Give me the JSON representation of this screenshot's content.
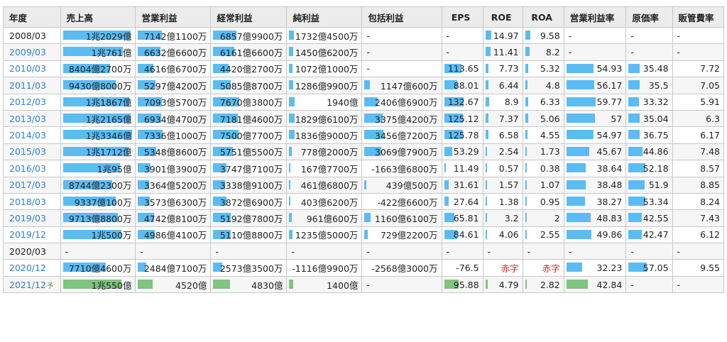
{
  "colors": {
    "actual_bar": "#5bbcf3",
    "forecast_bar": "#7fc47f",
    "link": "#2d7ed8",
    "deficit": "#dd2222"
  },
  "headers": [
    "年度",
    "売上高",
    "営業利益",
    "経常利益",
    "純利益",
    "包括利益",
    "EPS",
    "ROE",
    "ROA",
    "営業利益率",
    "原価率",
    "販管費率"
  ],
  "rows": [
    {
      "year": "2008/03",
      "link": false,
      "cells": [
        {
          "text": "1兆2029億",
          "bar": 0.98
        },
        {
          "text": "7142億1100万",
          "bar": 0.35
        },
        {
          "text": "6857億9900万",
          "bar": 0.34
        },
        {
          "text": "1732億4500万",
          "bar": 0.07
        },
        {
          "text": "-",
          "bar": 0
        },
        {
          "text": "-",
          "bar": 0
        },
        {
          "text": "14.97",
          "bar": 0.18
        },
        {
          "text": "9.58",
          "bar": 0.14
        },
        {
          "text": "-",
          "bar": 0
        },
        {
          "text": "-",
          "bar": 0
        },
        {
          "text": "-",
          "bar": 0
        }
      ]
    },
    {
      "year": "2009/03",
      "link": true,
      "cells": [
        {
          "text": "1兆761億",
          "bar": 0.87
        },
        {
          "text": "6632億6600万",
          "bar": 0.33
        },
        {
          "text": "6161億6600万",
          "bar": 0.31
        },
        {
          "text": "1450億6200万",
          "bar": 0.06
        },
        {
          "text": "-",
          "bar": 0
        },
        {
          "text": "-",
          "bar": 0
        },
        {
          "text": "11.41",
          "bar": 0.14
        },
        {
          "text": "8.2",
          "bar": 0.12
        },
        {
          "text": "-",
          "bar": 0
        },
        {
          "text": "-",
          "bar": 0
        },
        {
          "text": "-",
          "bar": 0
        }
      ]
    },
    {
      "year": "2010/03",
      "link": true,
      "cells": [
        {
          "text": "8404億2700万",
          "bar": 0.68
        },
        {
          "text": "4616億6700万",
          "bar": 0.23
        },
        {
          "text": "4420億2700万",
          "bar": 0.22
        },
        {
          "text": "1072億1000万",
          "bar": 0.05
        },
        {
          "text": "-",
          "bar": 0
        },
        {
          "text": "113.65",
          "bar": 0.48
        },
        {
          "text": "7.73",
          "bar": 0.09
        },
        {
          "text": "5.32",
          "bar": 0.08
        },
        {
          "text": "54.93",
          "bar": 0.48
        },
        {
          "text": "35.48",
          "bar": 0.28
        },
        {
          "text": "7.72",
          "bar": 0
        }
      ]
    },
    {
      "year": "2011/03",
      "link": true,
      "cells": [
        {
          "text": "9430億8000万",
          "bar": 0.76
        },
        {
          "text": "5297億4200万",
          "bar": 0.26
        },
        {
          "text": "5085億8700万",
          "bar": 0.25
        },
        {
          "text": "1286億9900万",
          "bar": 0.06
        },
        {
          "text": "1147億600万",
          "bar": 0.08
        },
        {
          "text": "88.01",
          "bar": 0.37
        },
        {
          "text": "6.44",
          "bar": 0.08
        },
        {
          "text": "4.8",
          "bar": 0.07
        },
        {
          "text": "56.17",
          "bar": 0.49
        },
        {
          "text": "35.5",
          "bar": 0.28
        },
        {
          "text": "7.05",
          "bar": 0
        }
      ]
    },
    {
      "year": "2012/03",
      "link": true,
      "cells": [
        {
          "text": "1兆1867億",
          "bar": 0.96
        },
        {
          "text": "7093億5700万",
          "bar": 0.35
        },
        {
          "text": "7670億3800万",
          "bar": 0.38
        },
        {
          "text": "1940億",
          "bar": 0.08
        },
        {
          "text": "2406億6900万",
          "bar": 0.18
        },
        {
          "text": "132.67",
          "bar": 0.56
        },
        {
          "text": "8.9",
          "bar": 0.11
        },
        {
          "text": "6.33",
          "bar": 0.09
        },
        {
          "text": "59.77",
          "bar": 0.52
        },
        {
          "text": "33.32",
          "bar": 0.26
        },
        {
          "text": "5.91",
          "bar": 0
        }
      ]
    },
    {
      "year": "2013/03",
      "link": true,
      "cells": [
        {
          "text": "1兆2165億",
          "bar": 0.98
        },
        {
          "text": "6934億4700万",
          "bar": 0.34
        },
        {
          "text": "7181億4600万",
          "bar": 0.36
        },
        {
          "text": "1829億6100万",
          "bar": 0.08
        },
        {
          "text": "3375億4200万",
          "bar": 0.25
        },
        {
          "text": "125.12",
          "bar": 0.53
        },
        {
          "text": "7.37",
          "bar": 0.09
        },
        {
          "text": "5.06",
          "bar": 0.08
        },
        {
          "text": "57",
          "bar": 0.5
        },
        {
          "text": "35.04",
          "bar": 0.28
        },
        {
          "text": "6.3",
          "bar": 0
        }
      ]
    },
    {
      "year": "2014/03",
      "link": true,
      "cells": [
        {
          "text": "1兆3346億",
          "bar": 1.0
        },
        {
          "text": "7336億1000万",
          "bar": 0.36
        },
        {
          "text": "7500億7700万",
          "bar": 0.37
        },
        {
          "text": "1836億9000万",
          "bar": 0.08
        },
        {
          "text": "3456億7200万",
          "bar": 0.26
        },
        {
          "text": "125.78",
          "bar": 0.53
        },
        {
          "text": "6.58",
          "bar": 0.08
        },
        {
          "text": "4.55",
          "bar": 0.07
        },
        {
          "text": "54.97",
          "bar": 0.48
        },
        {
          "text": "36.75",
          "bar": 0.29
        },
        {
          "text": "6.17",
          "bar": 0
        }
      ]
    },
    {
      "year": "2015/03",
      "link": true,
      "cells": [
        {
          "text": "1兆1712億",
          "bar": 0.95
        },
        {
          "text": "5348億8600万",
          "bar": 0.27
        },
        {
          "text": "5751億5500万",
          "bar": 0.29
        },
        {
          "text": "778億2000万",
          "bar": 0.04
        },
        {
          "text": "3069億7900万",
          "bar": 0.23
        },
        {
          "text": "53.29",
          "bar": 0.22
        },
        {
          "text": "2.54",
          "bar": 0.03
        },
        {
          "text": "1.73",
          "bar": 0.03
        },
        {
          "text": "45.67",
          "bar": 0.4
        },
        {
          "text": "44.86",
          "bar": 0.36
        },
        {
          "text": "7.48",
          "bar": 0
        }
      ]
    },
    {
      "year": "2016/03",
      "link": true,
      "cells": [
        {
          "text": "1兆95億",
          "bar": 0.82
        },
        {
          "text": "3901億3900万",
          "bar": 0.19
        },
        {
          "text": "3747億7100万",
          "bar": 0.19
        },
        {
          "text": "167億7700万",
          "bar": 0.01
        },
        {
          "text": "-1663億6800万",
          "bar": 0
        },
        {
          "text": "11.49",
          "bar": 0.05
        },
        {
          "text": "0.57",
          "bar": 0.01
        },
        {
          "text": "0.38",
          "bar": 0.01
        },
        {
          "text": "38.64",
          "bar": 0.34
        },
        {
          "text": "52.18",
          "bar": 0.42
        },
        {
          "text": "8.57",
          "bar": 0
        }
      ]
    },
    {
      "year": "2017/03",
      "link": true,
      "cells": [
        {
          "text": "8744億2300万",
          "bar": 0.71
        },
        {
          "text": "3364億5200万",
          "bar": 0.17
        },
        {
          "text": "3338億9100万",
          "bar": 0.17
        },
        {
          "text": "461億6800万",
          "bar": 0.02
        },
        {
          "text": "439億500万",
          "bar": 0.03
        },
        {
          "text": "31.61",
          "bar": 0.13
        },
        {
          "text": "1.57",
          "bar": 0.02
        },
        {
          "text": "1.07",
          "bar": 0.02
        },
        {
          "text": "38.48",
          "bar": 0.34
        },
        {
          "text": "51.9",
          "bar": 0.41
        },
        {
          "text": "8.85",
          "bar": 0
        }
      ]
    },
    {
      "year": "2018/03",
      "link": true,
      "cells": [
        {
          "text": "9337億100万",
          "bar": 0.76
        },
        {
          "text": "3573億6300万",
          "bar": 0.18
        },
        {
          "text": "3872億6900万",
          "bar": 0.19
        },
        {
          "text": "403億6200万",
          "bar": 0.02
        },
        {
          "text": "-422億6600万",
          "bar": 0
        },
        {
          "text": "27.64",
          "bar": 0.12
        },
        {
          "text": "1.38",
          "bar": 0.02
        },
        {
          "text": "0.95",
          "bar": 0.01
        },
        {
          "text": "38.27",
          "bar": 0.33
        },
        {
          "text": "53.34",
          "bar": 0.43
        },
        {
          "text": "8.24",
          "bar": 0
        }
      ]
    },
    {
      "year": "2019/03",
      "link": true,
      "cells": [
        {
          "text": "9713億8800万",
          "bar": 0.79
        },
        {
          "text": "4742億8100万",
          "bar": 0.24
        },
        {
          "text": "5192億7800万",
          "bar": 0.26
        },
        {
          "text": "961億600万",
          "bar": 0.04
        },
        {
          "text": "1160億6100万",
          "bar": 0.09
        },
        {
          "text": "65.81",
          "bar": 0.28
        },
        {
          "text": "3.2",
          "bar": 0.04
        },
        {
          "text": "2",
          "bar": 0.03
        },
        {
          "text": "48.83",
          "bar": 0.43
        },
        {
          "text": "42.55",
          "bar": 0.34
        },
        {
          "text": "7.43",
          "bar": 0
        }
      ]
    },
    {
      "year": "2019/12",
      "link": true,
      "cells": [
        {
          "text": "1兆500万",
          "bar": 0.85
        },
        {
          "text": "4986億4100万",
          "bar": 0.25
        },
        {
          "text": "5110億8800万",
          "bar": 0.25
        },
        {
          "text": "1235億5000万",
          "bar": 0.05
        },
        {
          "text": "729億2200万",
          "bar": 0.05
        },
        {
          "text": "84.61",
          "bar": 0.36
        },
        {
          "text": "4.06",
          "bar": 0.05
        },
        {
          "text": "2.55",
          "bar": 0.04
        },
        {
          "text": "49.86",
          "bar": 0.44
        },
        {
          "text": "42.47",
          "bar": 0.34
        },
        {
          "text": "6.12",
          "bar": 0
        }
      ]
    },
    {
      "year": "2020/03",
      "link": false,
      "cells": [
        {
          "text": "-",
          "bar": 0
        },
        {
          "text": "-",
          "bar": 0
        },
        {
          "text": "-",
          "bar": 0
        },
        {
          "text": "-",
          "bar": 0
        },
        {
          "text": "-",
          "bar": 0
        },
        {
          "text": "-",
          "bar": 0
        },
        {
          "text": "-",
          "bar": 0
        },
        {
          "text": "-",
          "bar": 0
        },
        {
          "text": "-",
          "bar": 0
        },
        {
          "text": "-",
          "bar": 0
        },
        {
          "text": "-",
          "bar": 0
        }
      ]
    },
    {
      "year": "2020/12",
      "link": true,
      "cells": [
        {
          "text": "7710億4600万",
          "bar": 0.62
        },
        {
          "text": "2484億7100万",
          "bar": 0.12
        },
        {
          "text": "2573億3500万",
          "bar": 0.13
        },
        {
          "text": "-1116億9900万",
          "bar": 0
        },
        {
          "text": "-2568億3000万",
          "bar": 0
        },
        {
          "text": "-76.5",
          "bar": 0
        },
        {
          "text": "赤字",
          "bar": 0,
          "neg": true
        },
        {
          "text": "赤字",
          "bar": 0,
          "neg": true
        },
        {
          "text": "32.23",
          "bar": 0.28
        },
        {
          "text": "57.05",
          "bar": 0.46
        },
        {
          "text": "9.55",
          "bar": 0
        }
      ]
    },
    {
      "year": "2021/12",
      "link": true,
      "forecast": true,
      "forecast_mark": "予",
      "cells": [
        {
          "text": "1兆550億",
          "bar": 0.85
        },
        {
          "text": "4520億",
          "bar": 0.22
        },
        {
          "text": "4830億",
          "bar": 0.24
        },
        {
          "text": "1400億",
          "bar": 0.06
        },
        {
          "text": "-",
          "bar": 0
        },
        {
          "text": "95.88",
          "bar": 0.41
        },
        {
          "text": "4.79",
          "bar": 0.06
        },
        {
          "text": "2.82",
          "bar": 0.04
        },
        {
          "text": "42.84",
          "bar": 0.38
        },
        {
          "text": "-",
          "bar": 0
        },
        {
          "text": "-",
          "bar": 0
        }
      ]
    }
  ]
}
